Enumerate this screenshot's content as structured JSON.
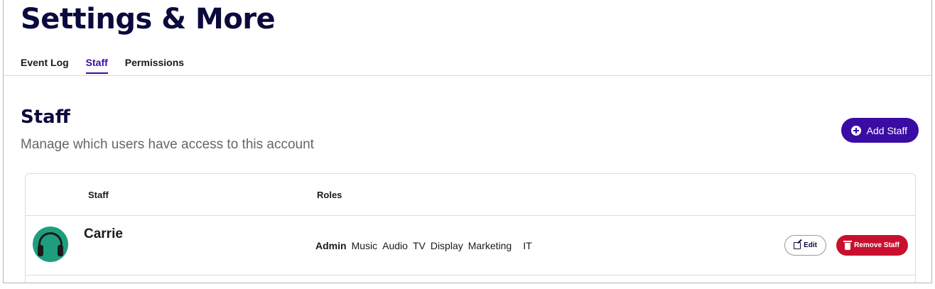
{
  "page": {
    "title": "Settings & More"
  },
  "tabs": [
    {
      "label": "Event Log",
      "active": false
    },
    {
      "label": "Staff",
      "active": true
    },
    {
      "label": "Permissions",
      "active": false
    }
  ],
  "section": {
    "title": "Staff",
    "subtitle": "Manage which users have access to this account",
    "add_button_label": "Add Staff",
    "add_button_icon": "plus-circle-icon"
  },
  "table": {
    "headers": {
      "staff": "Staff",
      "roles": "Roles"
    },
    "rows": [
      {
        "avatar_icon": "headphones-avatar-icon",
        "name": "Carrie",
        "roles_primary": "Admin",
        "roles": [
          "Music",
          "Audio",
          "TV",
          "Display",
          "Marketing",
          "IT"
        ],
        "edit_label": "Edit",
        "edit_icon": "edit-icon",
        "remove_label": "Remove Staff",
        "remove_icon": "trash-icon"
      }
    ]
  },
  "colors": {
    "title": "#0b0a3d",
    "accent": "#3a0ca3",
    "danger": "#c8102e",
    "avatar": "#1f9e7f"
  }
}
